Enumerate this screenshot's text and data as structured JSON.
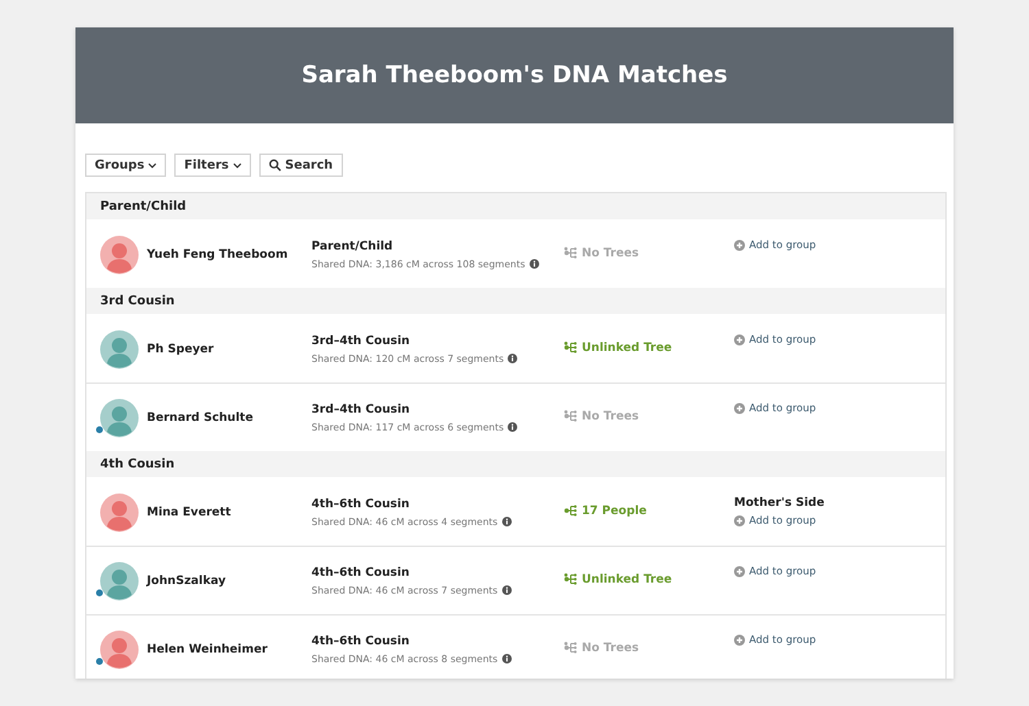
{
  "header": {
    "title": "Sarah Theeboom's DNA Matches"
  },
  "toolbar": [
    {
      "kind": "dropdown",
      "label": "Groups"
    },
    {
      "kind": "dropdown",
      "label": "Filters"
    },
    {
      "kind": "search",
      "label": "Search"
    }
  ],
  "sections": [
    {
      "title": "Parent/Child",
      "matches": [
        {
          "name": "Yueh Feng Theeboom",
          "color": "#e8706e",
          "new": false,
          "relationship": "Parent/Child",
          "shared_dna": "Shared DNA: 3,186 cM across 108 segments",
          "tree": {
            "kind": "none",
            "label": "No Trees"
          },
          "add_label": "Add to group"
        }
      ]
    },
    {
      "title": "3rd Cousin",
      "matches": [
        {
          "name": "Ph Speyer",
          "color": "#5ba5a0",
          "new": false,
          "relationship": "3rd–4th Cousin",
          "shared_dna": "Shared DNA: 120 cM across 7 segments",
          "tree": {
            "kind": "unlinked",
            "label": "Unlinked Tree"
          },
          "add_label": "Add to group"
        },
        {
          "name": "Bernard Schulte",
          "color": "#5ba5a0",
          "new": true,
          "relationship": "3rd–4th Cousin",
          "shared_dna": "Shared DNA: 117 cM across 6 segments",
          "tree": {
            "kind": "none",
            "label": "No Trees"
          },
          "add_label": "Add to group"
        }
      ]
    },
    {
      "title": "4th Cousin",
      "matches": [
        {
          "name": "Mina Everett",
          "color": "#e8706e",
          "new": false,
          "relationship": "4th–6th Cousin",
          "shared_dna": "Shared DNA: 46 cM across 4 segments",
          "tree": {
            "kind": "people",
            "label": "17 People"
          },
          "group_label": "Mother's Side",
          "add_label": "Add to group"
        },
        {
          "name": "JohnSzalkay",
          "color": "#5ba5a0",
          "new": true,
          "relationship": "4th–6th Cousin",
          "shared_dna": "Shared DNA: 46 cM across 7 segments",
          "tree": {
            "kind": "unlinked",
            "label": "Unlinked Tree"
          },
          "add_label": "Add to group"
        },
        {
          "name": "Helen Weinheimer",
          "color": "#e8706e",
          "new": true,
          "relationship": "4th–6th Cousin",
          "shared_dna": "Shared DNA: 46 cM across 8 segments",
          "tree": {
            "kind": "none",
            "label": "No Trees"
          },
          "add_label": "Add to group"
        }
      ]
    }
  ]
}
